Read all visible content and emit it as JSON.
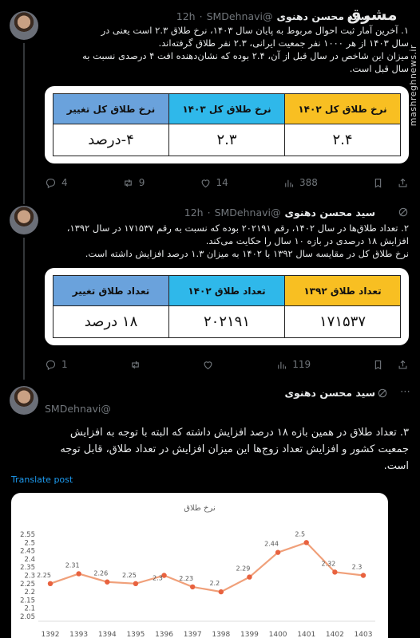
{
  "watermark": {
    "logo": "مشرق",
    "site": "mashreghnews.ir"
  },
  "author": {
    "name": "سید محسن دهنوی",
    "handle": "@SMDehnavi",
    "sep": "·"
  },
  "tweets": [
    {
      "time": "12h",
      "text": [
        "۱. آخرین آمار ثبت احوال مربوط به پایان سال ۱۴۰۳، نرخ طلاق ۲.۳ است یعنی در",
        "سال ۱۴۰۳ از هر ۱۰۰۰ نفر جمعیت ایرانی، ۲.۳ نفر طلاق گرفته‌اند.",
        "میزان این شاخص در سال قبل از آن، ۲.۴ بوده که نشان‌دهنده افت ۴ درصدی نسبت به",
        "سال قبل است."
      ],
      "table": {
        "headers": [
          "نرخ طلاق کل ۱۴۰۲",
          "نرخ طلاق کل ۱۴۰۳",
          "نرخ طلاق کل تغییر"
        ],
        "values": [
          "۲.۴",
          "۲.۳",
          "۴-درصد"
        ]
      },
      "stats": {
        "replies": "4",
        "reposts": "9",
        "likes": "14",
        "views": "388"
      }
    },
    {
      "time": "12h",
      "text": [
        "۲. تعداد طلاق‌ها در سال ۱۴۰۲، رقم ۲۰۲۱۹۱ بوده که نسبت به رقم ۱۷۱۵۳۷ در سال ۱۳۹۲،",
        "افزایش ۱۸ درصدی در بازه ۱۰ سال را حکایت می‌کند.",
        "نرخ طلاق کل در مقایسه سال ۱۳۹۲ با ۱۴۰۲ به میزان ۱.۳ درصد افزایش داشته است."
      ],
      "table": {
        "headers": [
          "تعداد طلاق ۱۳۹۲",
          "تعداد طلاق ۱۴۰۲",
          "تعداد طلاق تغییر"
        ],
        "values": [
          "۱۷۱۵۳۷",
          "۲۰۲۱۹۱",
          "۱۸ درصد"
        ]
      },
      "stats": {
        "replies": "1",
        "reposts": "",
        "likes": "",
        "views": "119"
      }
    },
    {
      "time": "",
      "text": [
        "۳. تعداد طلاق در همین بازه ۱۸ درصد افزایش داشته که البته با توجه به افزایش",
        "جمعیت کشور و افزایش تعداد زوج‌ها این میزان افزایش در تعداد طلاق، قابل توجه",
        "است."
      ],
      "translate": "Translate post"
    }
  ],
  "chart_data": {
    "type": "line",
    "title": "نرخ طلاق",
    "x": [
      "1392",
      "1393",
      "1394",
      "1395",
      "1396",
      "1397",
      "1398",
      "1399",
      "1400",
      "1401",
      "1402",
      "1403"
    ],
    "values": [
      2.25,
      2.31,
      2.26,
      2.25,
      2.3,
      2.23,
      2.2,
      2.29,
      2.44,
      2.5,
      2.32,
      2.3
    ],
    "data_labels": [
      "2.25",
      "2.31",
      "2.26",
      "2.25",
      "2.3",
      "2.23",
      "2.2",
      "2.29",
      "2.44",
      "2.5",
      "2.32",
      "2.3"
    ],
    "yticks": [
      "2.05",
      "2.1",
      "2.15",
      "2.2",
      "2.25",
      "2.3",
      "2.35",
      "2.4",
      "2.45",
      "2.5",
      "2.55"
    ],
    "ylim": [
      2.05,
      2.55
    ],
    "grid": false,
    "line_color": "#f0a07a",
    "marker_color": "#e8623f"
  },
  "colors": {
    "link": "#1d9bf0",
    "muted": "#71767b",
    "header_yellow": "#f8bf22",
    "header_cyan": "#2fb8ea",
    "header_blue": "#6aa2dc"
  }
}
